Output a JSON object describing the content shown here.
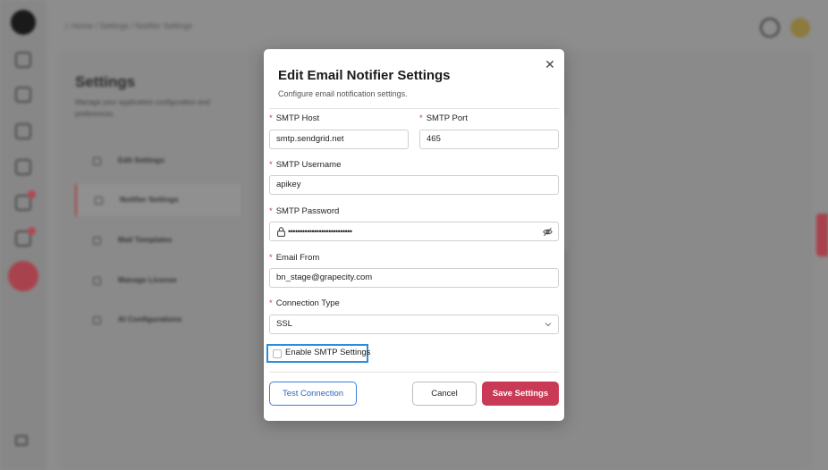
{
  "background": {
    "breadcrumb": "⌂ Home / Settings / Notifier Settings",
    "page_title": "Settings",
    "page_subtitle": "Manage your application configuration and preferences.",
    "nav_items": [
      {
        "label": "Edit Settings",
        "icon": "edit-icon"
      },
      {
        "label": "Notifier Settings",
        "icon": "notifier-icon"
      },
      {
        "label": "Mail Templates",
        "icon": "mail-icon"
      },
      {
        "label": "Manage License",
        "icon": "key-icon"
      },
      {
        "label": "AI Configurations",
        "icon": "ai-icon"
      }
    ],
    "active_nav": "Notifier Settings",
    "colors": {
      "accent": "#c83a55"
    }
  },
  "modal": {
    "title": "Edit Email Notifier Settings",
    "description": "Configure email notification settings.",
    "close_icon": "close-icon",
    "fields": {
      "smtp_host": {
        "label": "SMTP Host",
        "value": "smtp.sendgrid.net",
        "required": "*"
      },
      "smtp_port": {
        "label": "SMTP Port",
        "value": "465",
        "required": "*"
      },
      "smtp_username": {
        "label": "SMTP Username",
        "value": "apikey",
        "required": "*"
      },
      "smtp_password": {
        "label": "SMTP Password",
        "value": "•••••••••••••••••••••••••••",
        "required": "*"
      },
      "email_from": {
        "label": "Email From",
        "value": "bn_stage@grapecity.com",
        "required": "*"
      },
      "connection_type": {
        "label": "Connection Type",
        "value": "SSL",
        "required": "*"
      }
    },
    "enable_smtp": {
      "label": "Enable SMTP Settings",
      "checked": false
    },
    "buttons": {
      "test": "Test Connection",
      "cancel": "Cancel",
      "save": "Save Settings"
    },
    "colors": {
      "primary": "#c83a55",
      "link": "#2a66c4",
      "focus": "#2b8de0"
    }
  }
}
